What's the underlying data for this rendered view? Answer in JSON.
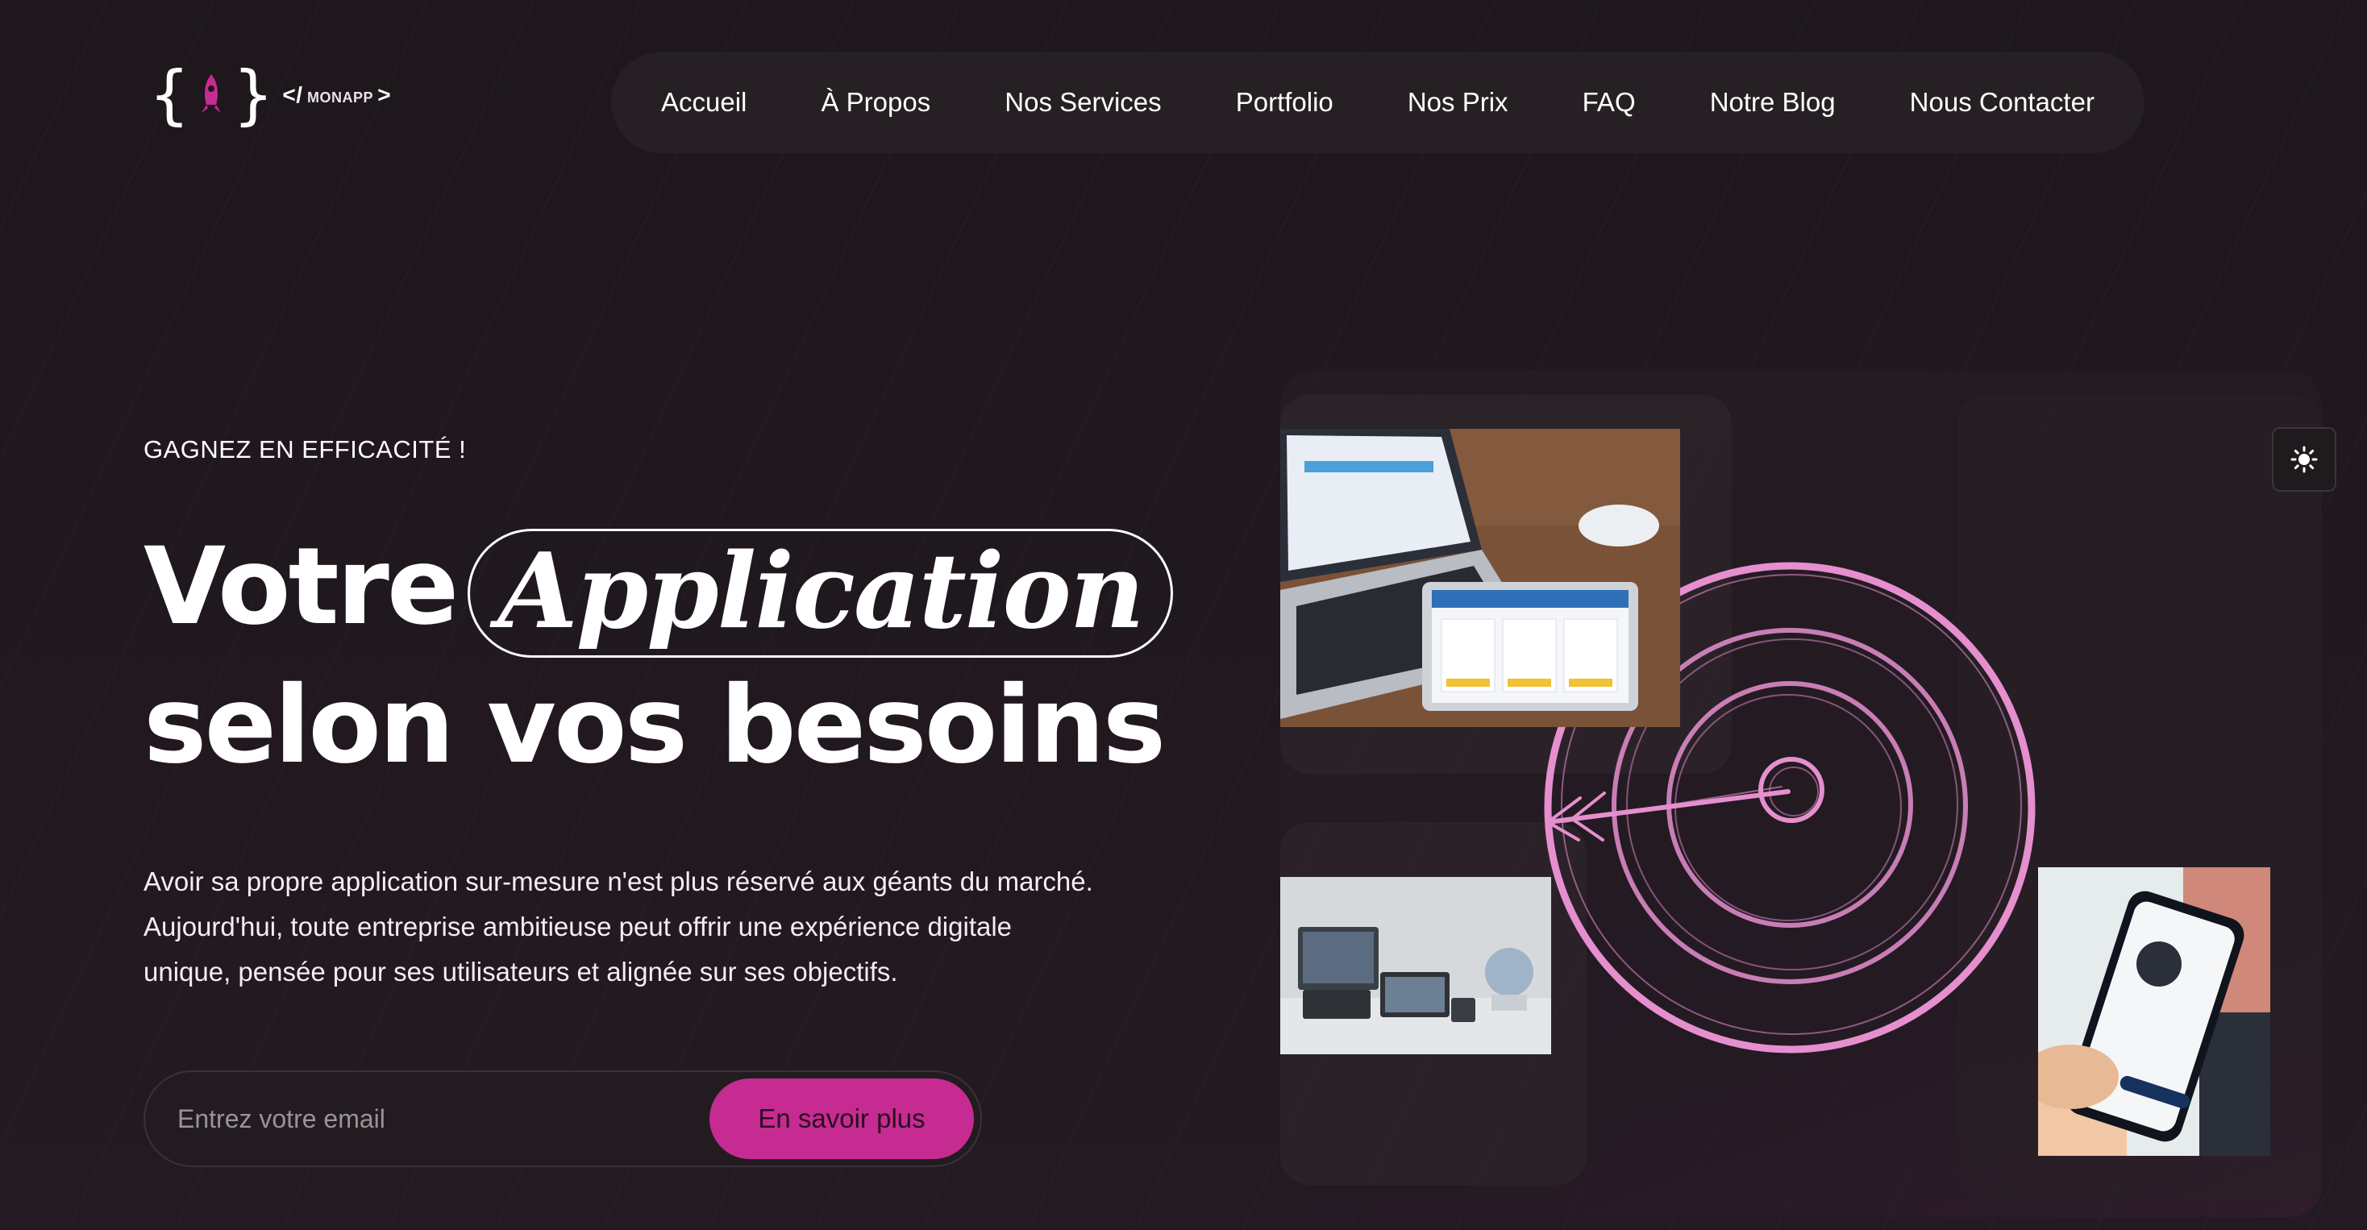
{
  "brand": {
    "logo_text": "MONAPP",
    "logo_tag": "</",
    "logo_tag_end": ">",
    "accent": "#c62b91"
  },
  "nav": {
    "items": [
      {
        "label": "Accueil"
      },
      {
        "label": "À Propos"
      },
      {
        "label": "Nos Services"
      },
      {
        "label": "Portfolio"
      },
      {
        "label": "Nos Prix"
      },
      {
        "label": "FAQ"
      },
      {
        "label": "Notre Blog"
      },
      {
        "label": "Nous Contacter"
      }
    ]
  },
  "hero": {
    "eyebrow": "GAGNEZ EN EFFICACITÉ !",
    "headline_part1": "Votre",
    "headline_highlight": "Application",
    "headline_part2": "selon vos besoins",
    "description_lines": [
      "Avoir sa propre application sur-mesure n'est plus réservé aux géants du marché.",
      "Aujourd'hui, toute entreprise ambitieuse peut offrir une expérience digitale",
      "unique, pensée pour ses utilisateurs et alignée sur ses objectifs."
    ],
    "email_placeholder": "Entrez votre email",
    "cta_label": "En savoir plus"
  },
  "visual": {
    "images": [
      "laptop-and-tablet-photo",
      "devices-lineup-photo",
      "phone-in-hand-photo"
    ],
    "target_color": "#e58fcf"
  },
  "theme_toggle": {
    "icon": "sun-icon"
  }
}
